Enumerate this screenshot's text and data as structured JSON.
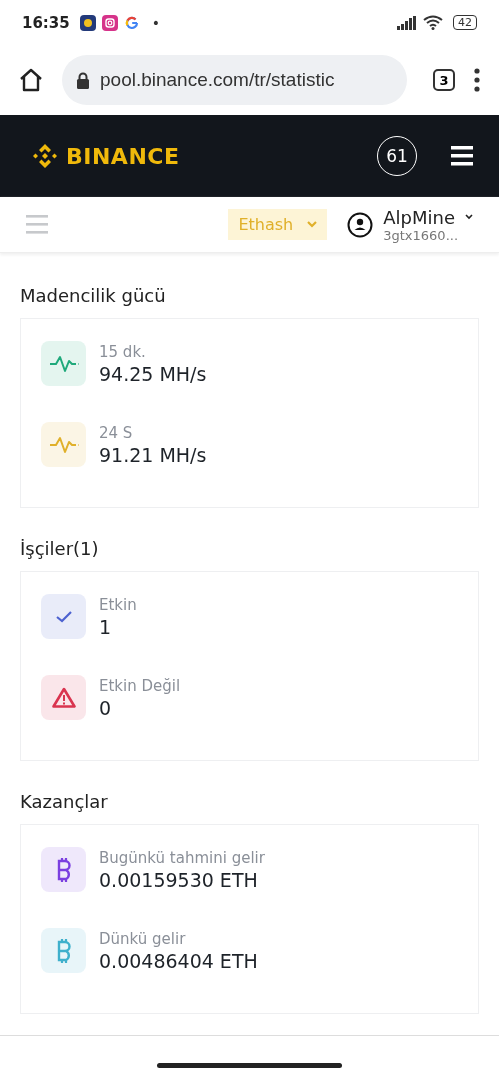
{
  "status_bar": {
    "time": "16:35",
    "notification_dot": "•",
    "battery": "42"
  },
  "browser": {
    "url": "pool.binance.com/tr/statistic",
    "tab_count": "3"
  },
  "header": {
    "logo": "BINANCE",
    "badge": "61"
  },
  "subnav": {
    "algorithm": "Ethash",
    "account": "AlpMine",
    "worker": "3gtx1660..."
  },
  "sections": [
    {
      "title": "Madencilik gücü",
      "items": [
        {
          "kind": "pulse",
          "color": "#1fa97b",
          "label": "15 dk.",
          "value": "94.25 MH/s"
        },
        {
          "kind": "pulse",
          "color": "#e0b02a",
          "label": "24 S",
          "value": "91.21 MH/s"
        }
      ]
    },
    {
      "title": "İşçiler(1)",
      "items": [
        {
          "kind": "check",
          "color": "#4d62d0",
          "label": "Etkin",
          "value": "1"
        },
        {
          "kind": "warning",
          "color": "#d9344f",
          "label": "Etkin Değil",
          "value": "0"
        }
      ]
    },
    {
      "title": "Kazançlar",
      "items": [
        {
          "kind": "coin",
          "color": "#7b3fe0",
          "label": "Bugünkü tahmini gelir",
          "value": "0.00159530 ETH"
        },
        {
          "kind": "coin",
          "color": "#3fb0cc",
          "label": "Dünkü gelir",
          "value": "0.00486404 ETH"
        }
      ]
    }
  ]
}
